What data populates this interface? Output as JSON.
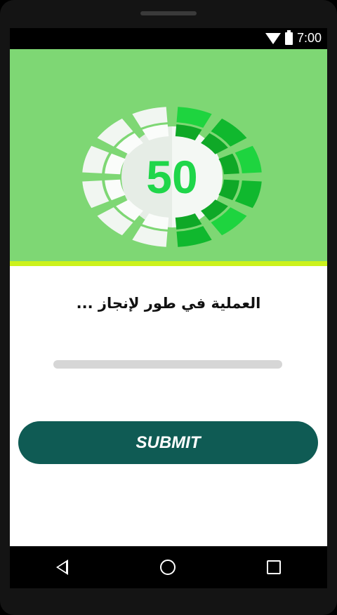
{
  "status_bar": {
    "time": "7:00",
    "icons": [
      "wifi-icon",
      "battery-icon"
    ]
  },
  "hero": {
    "background_color": "#7ed774",
    "accent_border_color": "#ccf21c",
    "progress_value": "50",
    "progress_fraction": 0.5,
    "gauge_colors": {
      "number": "#1fd64a",
      "filled_segments": [
        "#1ed43f",
        "#10b82e",
        "#0fa827"
      ],
      "empty_segments": "#f1f6f1",
      "empty_inner": "#e6ede6"
    }
  },
  "status": {
    "message": "العملية في طور لإنجاز ..."
  },
  "progress_bar": {
    "value": 0,
    "track_color": "#d6d6d6"
  },
  "submit": {
    "label": "SUBMIT",
    "color": "#0f5b54"
  },
  "nav": {
    "icons": [
      "back-icon",
      "home-icon",
      "recents-icon"
    ]
  }
}
